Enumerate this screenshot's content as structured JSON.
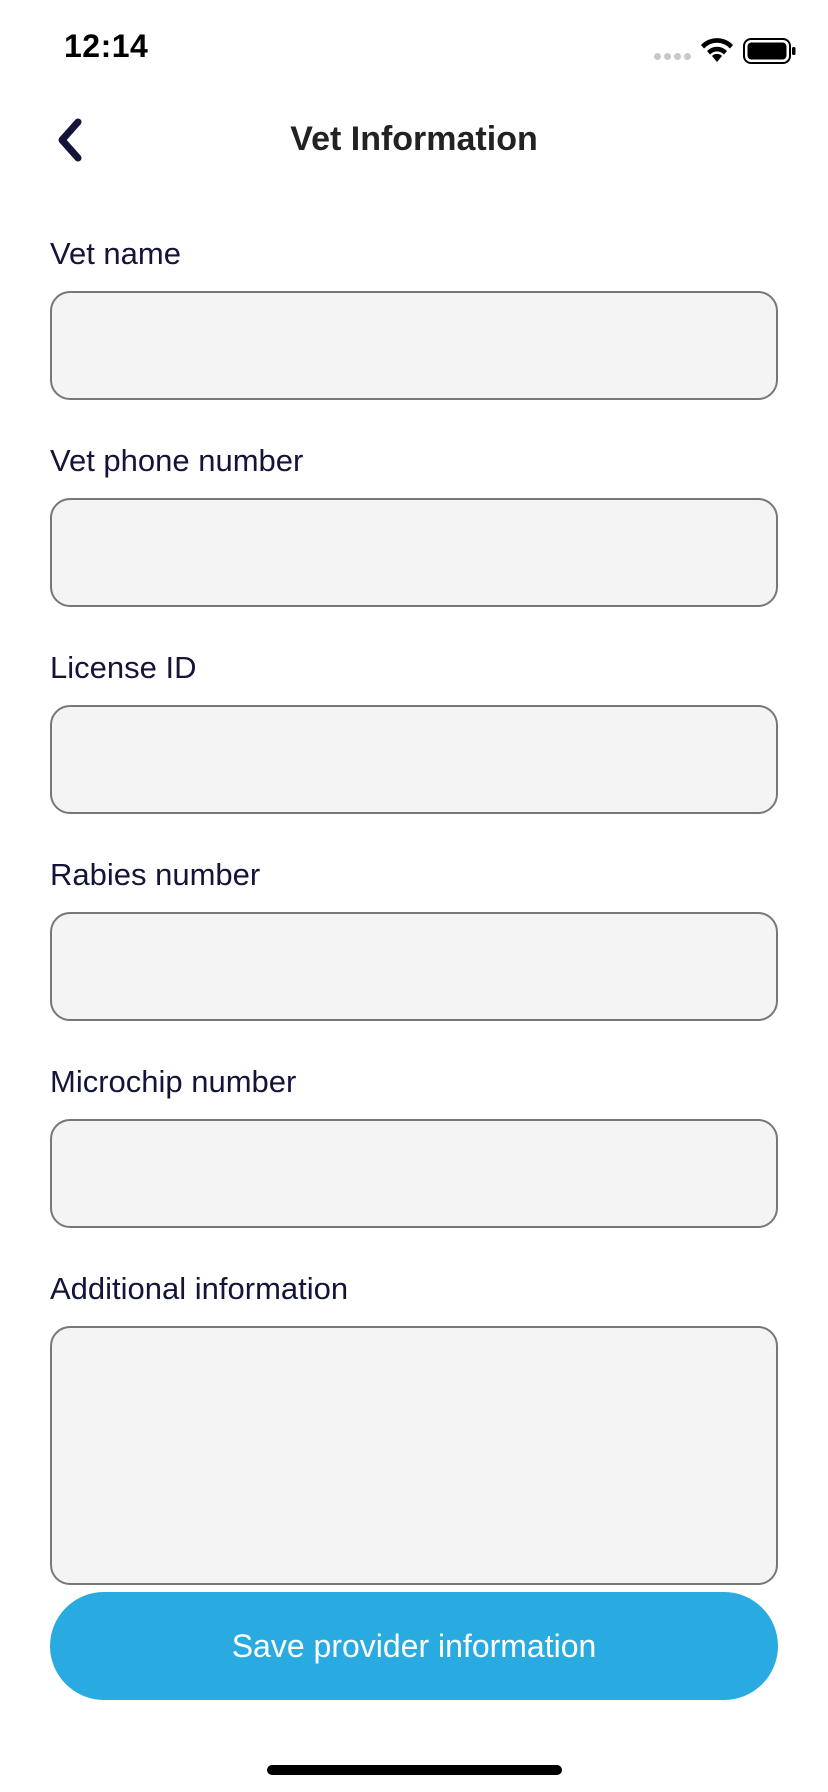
{
  "status_bar": {
    "time": "12:14"
  },
  "nav": {
    "title": "Vet Information",
    "back_icon": "chevron-left-icon"
  },
  "form": {
    "fields": [
      {
        "label": "Vet name",
        "value": "",
        "placeholder": ""
      },
      {
        "label": "Vet phone number",
        "value": "",
        "placeholder": ""
      },
      {
        "label": "License ID",
        "value": "",
        "placeholder": ""
      },
      {
        "label": "Rabies number",
        "value": "",
        "placeholder": ""
      },
      {
        "label": "Microchip number",
        "value": "",
        "placeholder": ""
      },
      {
        "label": "Additional information",
        "value": "",
        "placeholder": ""
      }
    ],
    "save_label": "Save provider information"
  },
  "colors": {
    "accent": "#29abe2",
    "text": "#14143a",
    "input_bg": "#f4f4f4",
    "input_border": "#777777"
  }
}
